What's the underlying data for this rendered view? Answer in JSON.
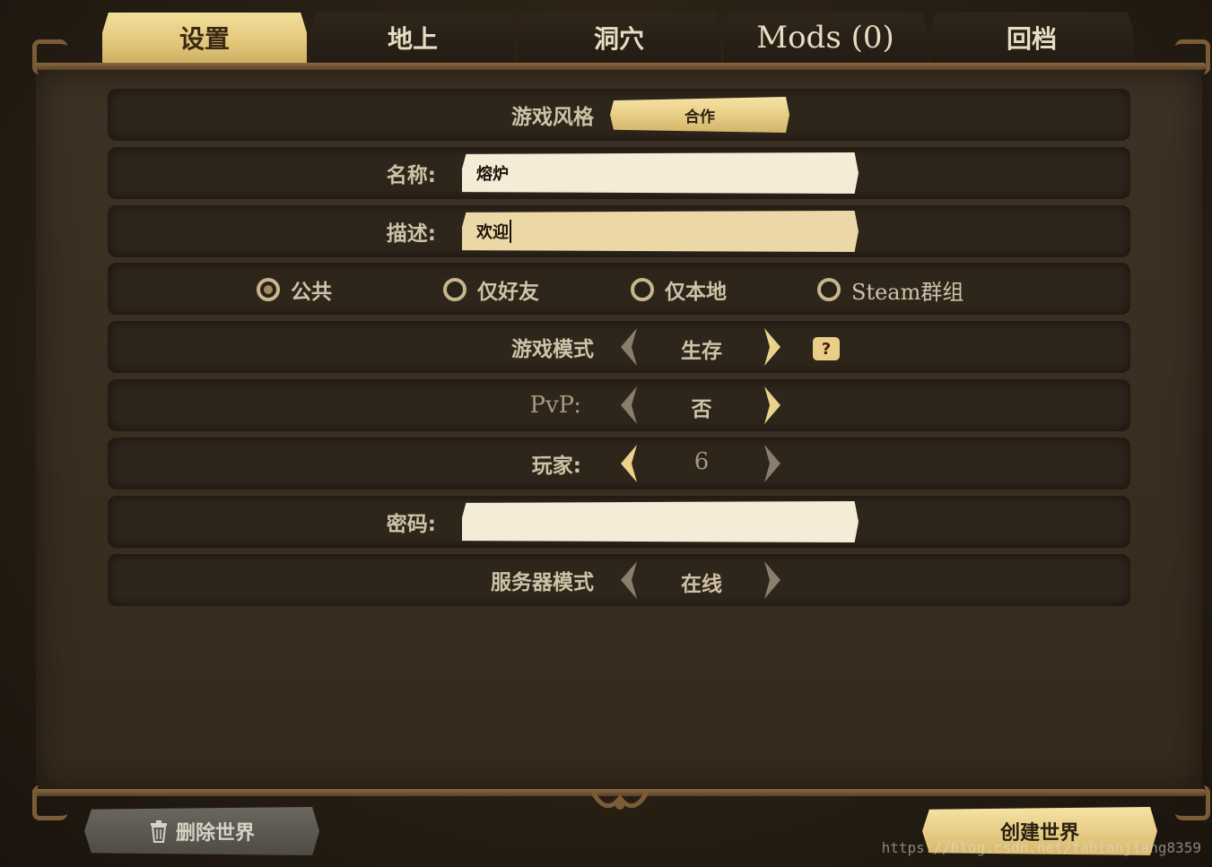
{
  "tabs": [
    {
      "label": "设置",
      "active": true
    },
    {
      "label": "地上",
      "active": false
    },
    {
      "label": "洞穴",
      "active": false
    },
    {
      "label": "Mods (0)",
      "active": false
    },
    {
      "label": "回档",
      "active": false
    }
  ],
  "settings": {
    "game_style": {
      "label": "游戏风格",
      "value": "合作"
    },
    "name": {
      "label": "名称:",
      "value": "熔炉"
    },
    "description": {
      "label": "描述:",
      "value": "欢迎"
    },
    "privacy": {
      "options": [
        "公共",
        "仅好友",
        "仅本地",
        "Steam群组"
      ],
      "selected": "公共"
    },
    "game_mode": {
      "label": "游戏模式",
      "value": "生存",
      "help": "?"
    },
    "pvp": {
      "label": "PvP:",
      "value": "否"
    },
    "players": {
      "label": "玩家:",
      "value": "6"
    },
    "password": {
      "label": "密码:",
      "value": ""
    },
    "server_mode": {
      "label": "服务器模式",
      "value": "在线"
    }
  },
  "footer": {
    "delete_label": "删除世界",
    "create_label": "创建世界"
  },
  "watermark": "https://blog.csdn.net/fabianjiang8359",
  "colors": {
    "accent_gold": "#e6cc83",
    "panel": "#3a2e21",
    "text": "#cfc2a6"
  }
}
